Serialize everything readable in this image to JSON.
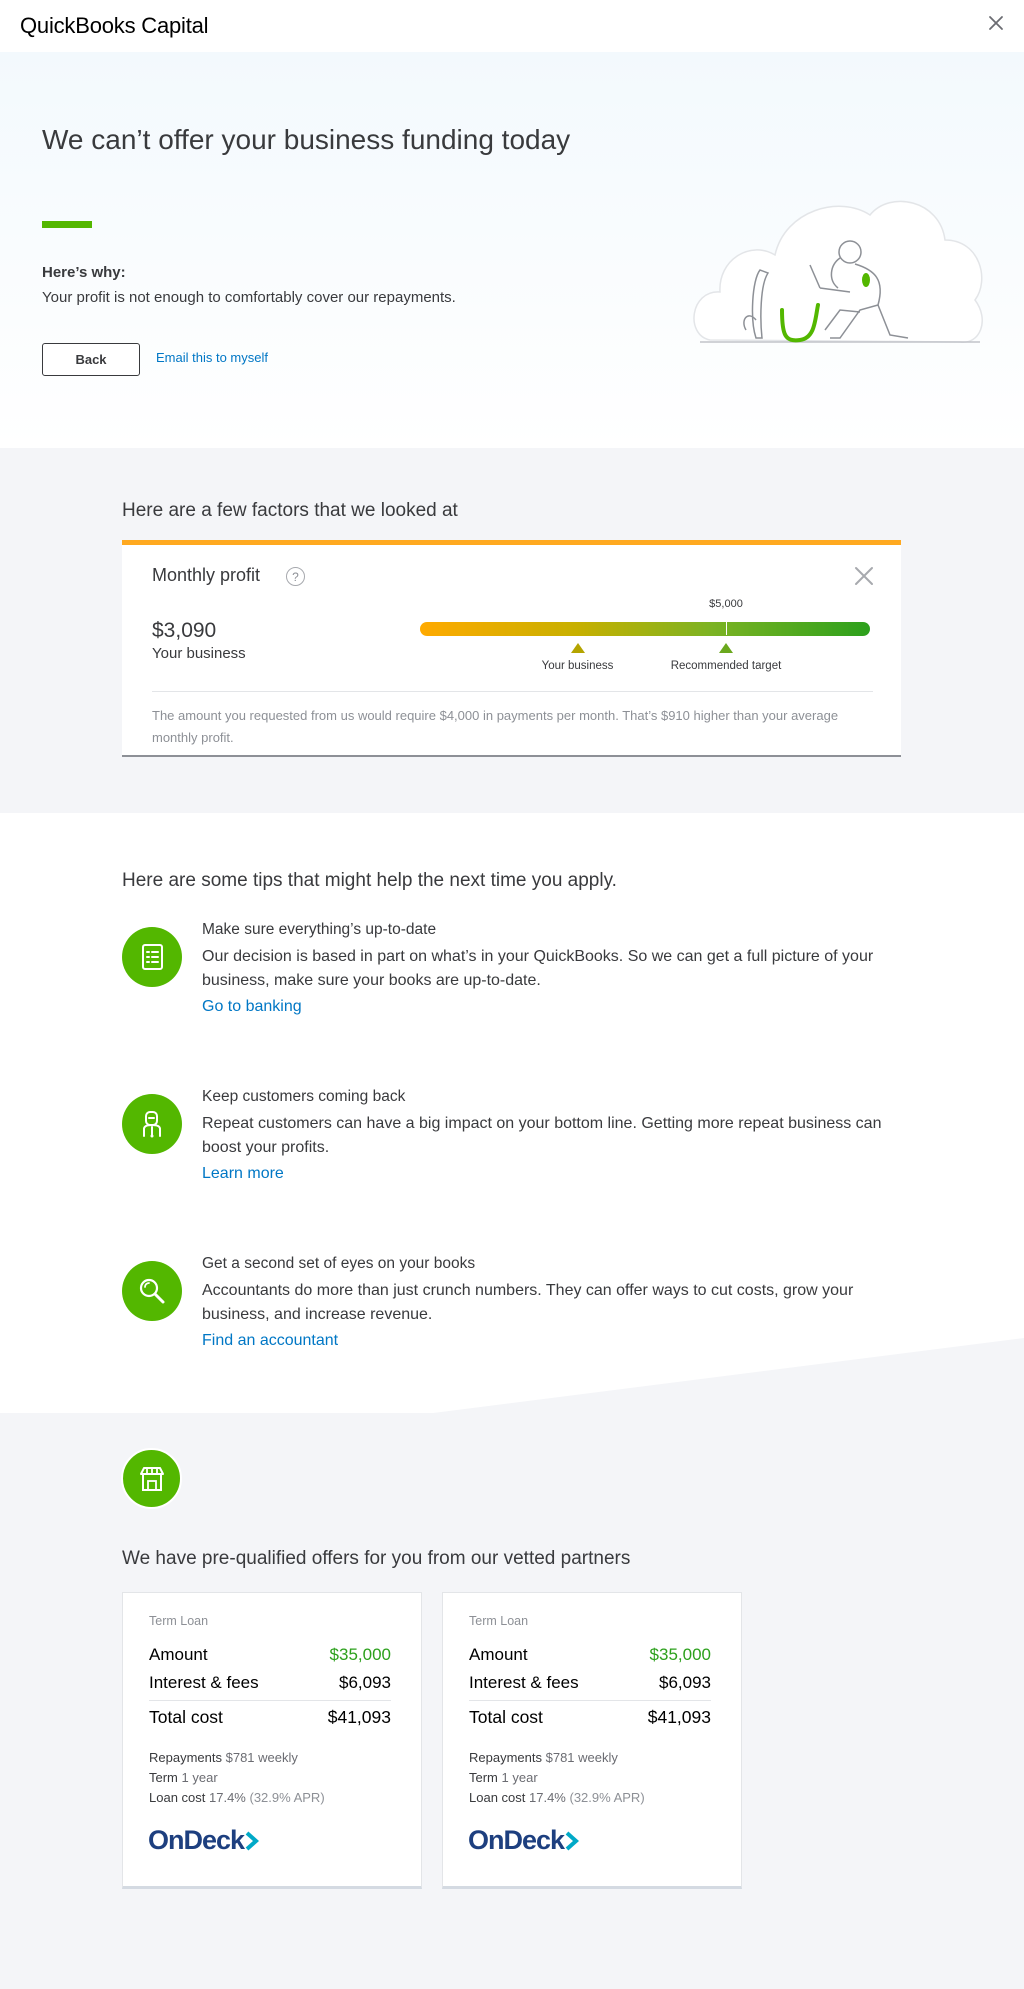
{
  "app": {
    "title": "QuickBooks Capital"
  },
  "hero": {
    "heading": "We can’t offer your business funding today",
    "why_label": "Here’s why:",
    "why_text": "Your profit is not enough to comfortably cover our repayments.",
    "back_label": "Back",
    "email_label": "Email this to myself"
  },
  "factors": {
    "heading": "Here are a few factors that we looked at",
    "card": {
      "title": "Monthly profit",
      "help_symbol": "?",
      "amount": "$3,090",
      "amount_label": "Your business",
      "target_value_label": "$5,000",
      "your_business_label": "Your business",
      "target_label": "Recommended target",
      "your_business_position": 0.35,
      "target_position": 0.68,
      "note": "The amount you requested from us would require $4,000 in payments per month. That’s $910 higher than your average monthly profit."
    }
  },
  "tips": {
    "heading": "Here are some tips that might help the next time you apply.",
    "items": [
      {
        "title": "Make sure everything’s up-to-date",
        "text": "Our decision is based in part on what’s in your QuickBooks. So we can get a full picture of your business, make sure your books are up-to-date.",
        "link": "Go to banking",
        "icon": "checklist-icon"
      },
      {
        "title": "Keep customers coming back",
        "text": "Repeat customers can have a big impact on your bottom line. Getting more repeat business can boost your profits.",
        "link": "Learn more",
        "icon": "customer-icon"
      },
      {
        "title": "Get a second set of eyes on your books",
        "text": "Accountants do more than just crunch numbers. They can offer ways to cut costs, grow your business, and increase revenue.",
        "link": "Find an accountant",
        "icon": "magnifier-icon"
      }
    ]
  },
  "offers": {
    "heading": "We have pre-qualified offers for you from our vetted partners",
    "cards": [
      {
        "kind": "Term Loan",
        "amount_label": "Amount",
        "amount_value": "$35,000",
        "fees_label": "Interest & fees",
        "fees_value": "$6,093",
        "total_label": "Total cost",
        "total_value": "$41,093",
        "repayments_label": "Repayments",
        "repayments_value": "$781 weekly",
        "term_label": "Term",
        "term_value": "1 year",
        "loancost_label": "Loan cost",
        "loancost_value": "17.4%",
        "apr_value": "(32.9% APR)",
        "partner": "OnDeck"
      },
      {
        "kind": "Term Loan",
        "amount_label": "Amount",
        "amount_value": "$35,000",
        "fees_label": "Interest & fees",
        "fees_value": "$6,093",
        "total_label": "Total cost",
        "total_value": "$41,093",
        "repayments_label": "Repayments",
        "repayments_value": "$781 weekly",
        "term_label": "Term",
        "term_value": "1 year",
        "loancost_label": "Loan cost",
        "loancost_value": "17.4%",
        "apr_value": "(32.9% APR)",
        "partner": "OnDeck"
      }
    ]
  },
  "colors": {
    "brand_green": "#53b700",
    "link_blue": "#0077c5",
    "warning_orange": "#ffa920",
    "amount_green": "#2ca01c",
    "partner_navy": "#1d3f7f"
  }
}
